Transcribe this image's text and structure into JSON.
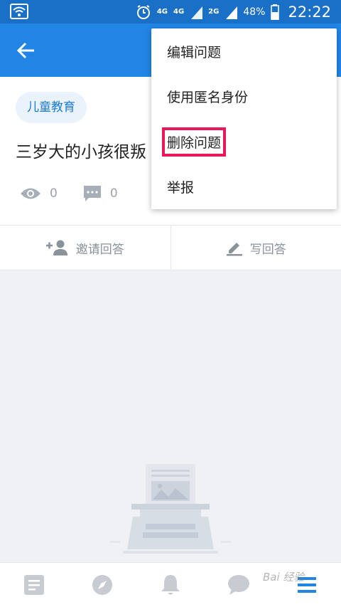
{
  "status_bar": {
    "network_1": "4G",
    "network_2": "4G",
    "network_3": "2G",
    "battery": "48%",
    "time": "22:22"
  },
  "question": {
    "topic_tag": "儿童教育",
    "title": "三岁大的小孩很叛",
    "view_count": "0",
    "comment_count": "0"
  },
  "actions": {
    "invite_label": "邀请回答",
    "write_label": "写回答"
  },
  "menu": {
    "items": [
      {
        "label": "编辑问题"
      },
      {
        "label": "使用匿名身份"
      },
      {
        "label": "删除问题"
      },
      {
        "label": "举报"
      }
    ],
    "highlighted_index": 2
  },
  "watermark": "Bai 经验",
  "colors": {
    "status_bar": "#1a6fc7",
    "app_bar": "#2185e6",
    "accent": "#1b7ad8",
    "highlight": "#e8185b"
  },
  "icons": [
    "wifi-icon",
    "alarm-icon",
    "signal-icon",
    "battery-icon",
    "back-arrow-icon",
    "eye-icon",
    "comment-icon",
    "add-person-icon",
    "pencil-icon",
    "typewriter-illustration",
    "feed-icon",
    "compass-icon",
    "bell-icon",
    "chat-icon",
    "menu-icon"
  ]
}
